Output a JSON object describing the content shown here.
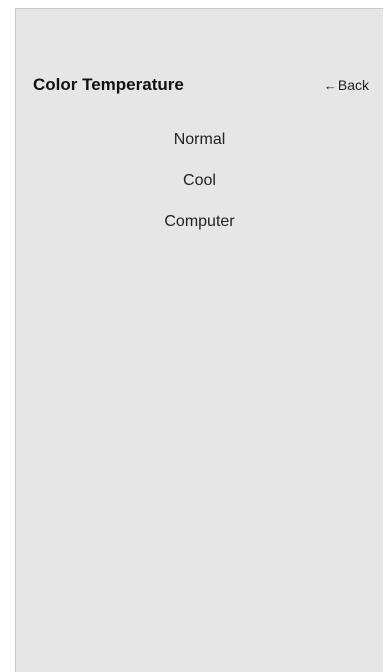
{
  "header": {
    "title": "Color Temperature",
    "back_arrow": "←",
    "back_label": "Back",
    "back_icon": "arrow-left-icon"
  },
  "menu": {
    "items": [
      {
        "label": "Normal"
      },
      {
        "label": "Cool"
      },
      {
        "label": "Computer"
      }
    ]
  },
  "colors": {
    "panel_background": "#e6e6e6",
    "text": "#222222"
  }
}
